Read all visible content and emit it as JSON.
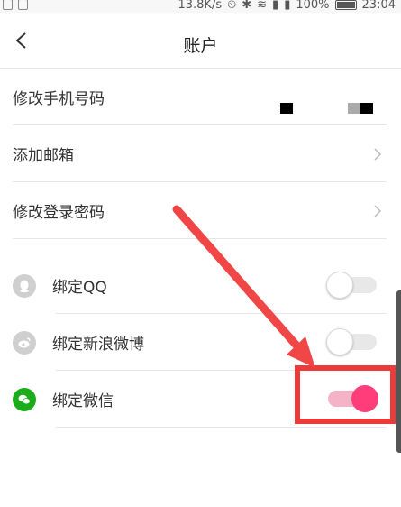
{
  "status_bar": {
    "network_speed": "13.8K/s",
    "battery": "100%",
    "time": "23:04"
  },
  "header": {
    "title": "账户"
  },
  "settings": {
    "change_phone": "修改手机号码",
    "add_email": "添加邮箱",
    "change_password": "修改登录密码"
  },
  "bindings": [
    {
      "label": "绑定QQ",
      "icon": "qq-icon",
      "icon_color": "#cfcfcf",
      "enabled": false
    },
    {
      "label": "绑定新浪微博",
      "icon": "weibo-icon",
      "icon_color": "#cfcfcf",
      "enabled": false
    },
    {
      "label": "绑定微信",
      "icon": "wechat-icon",
      "icon_color": "#1aad19",
      "enabled": true
    }
  ],
  "colors": {
    "accent": "#ff3d7a",
    "annotation": "#ec3b3b"
  }
}
